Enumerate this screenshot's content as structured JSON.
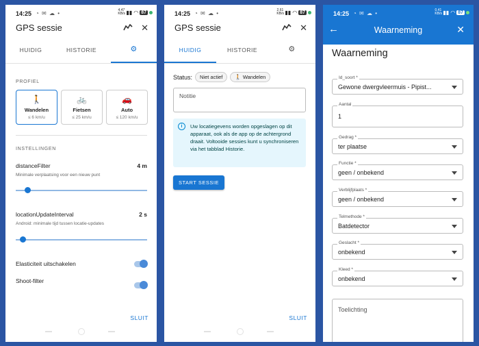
{
  "colors": {
    "accent": "#1976d2",
    "background": "#2b55a3",
    "info_bg": "#e5f6fd"
  },
  "screen1": {
    "status": {
      "time": "14:25",
      "icons": "◔ ✉ ☁ •",
      "net_top": "4.47",
      "net_bottom": "KB/s",
      "battery": "87"
    },
    "title": "GPS sessie",
    "title_icons": {
      "track": "track-icon",
      "close": "✕"
    },
    "tabs": [
      {
        "label": "HUIDIG"
      },
      {
        "label": "HISTORIE"
      },
      {
        "label": "⚙"
      }
    ],
    "profiel_label": "PROFIEL",
    "profiles": [
      {
        "icon": "🚶",
        "label": "Wandelen",
        "sub": "≤ 6 km/u"
      },
      {
        "icon": "🚲",
        "label": "Fietsen",
        "sub": "≤ 25 km/u"
      },
      {
        "icon": "🚗",
        "label": "Auto",
        "sub": "≤ 120 km/u"
      }
    ],
    "instellingen_label": "INSTELLINGEN",
    "settings": [
      {
        "name": "distanceFilter",
        "value": "4 m",
        "desc": "Minimale verplaatsing voor een nieuw punt",
        "level": 0.09
      },
      {
        "name": "locationUpdateInterval",
        "value": "2 s",
        "desc": "Android: minimale tijd tussen locatie-updates",
        "level": 0.05
      }
    ],
    "toggles": [
      {
        "label": "Elasticiteit uitschakelen",
        "on": true
      },
      {
        "label": "Shoot-filter",
        "on": true
      }
    ],
    "close_button": "SLUIT"
  },
  "screen2": {
    "status": {
      "time": "14:25",
      "icons": "◔ ✉ ☁ •",
      "net_top": "2.61",
      "net_bottom": "KB/s",
      "battery": "87"
    },
    "title": "GPS sessie",
    "title_icons": {
      "track": "track-icon",
      "close": "✕"
    },
    "tabs": [
      {
        "label": "HUIDIG"
      },
      {
        "label": "HISTORIE"
      },
      {
        "label": "⚙"
      }
    ],
    "status_label": "Status:",
    "status_chip": "Niet actief",
    "mode_chip_icon": "🚶",
    "mode_chip": "Wandelen",
    "notitie_placeholder": "Notitie",
    "info_icon": "i",
    "info_text": "Uw locatiegevens worden opgeslagen op dit apparaat, ook als de app op de achtergrond draait. Voltooide sessies kunt u synchroniseren via het tabblad Historie.",
    "start_button": "START SESSIE",
    "close_button": "SLUIT"
  },
  "screen3": {
    "status": {
      "time": "14:25",
      "icons": "◔ ✉ ☁ •",
      "net_top": "0.41",
      "net_bottom": "KB/s",
      "battery": "87"
    },
    "appbar_title": "Waarneming",
    "back_icon": "←",
    "close_icon": "✕",
    "form_title": "Waarneming",
    "fields": [
      {
        "label": "Id_soort *",
        "value": "Gewone dwergvleermuis - Pipist...",
        "dropdown": true
      },
      {
        "label": "Aantal",
        "value": "1",
        "dropdown": false
      },
      {
        "label": "Gedrag *",
        "value": "ter plaatse",
        "dropdown": true
      },
      {
        "label": "Functie *",
        "value": "geen / onbekend",
        "dropdown": true
      },
      {
        "label": "Verblijfplaats *",
        "value": "geen / onbekend",
        "dropdown": true
      },
      {
        "label": "Telmethode *",
        "value": "Batdetector",
        "dropdown": true
      },
      {
        "label": "Geslacht *",
        "value": "onbekend",
        "dropdown": true
      },
      {
        "label": "Kleed *",
        "value": "onbekend",
        "dropdown": true
      }
    ],
    "toelichting_placeholder": "Toelichting"
  }
}
